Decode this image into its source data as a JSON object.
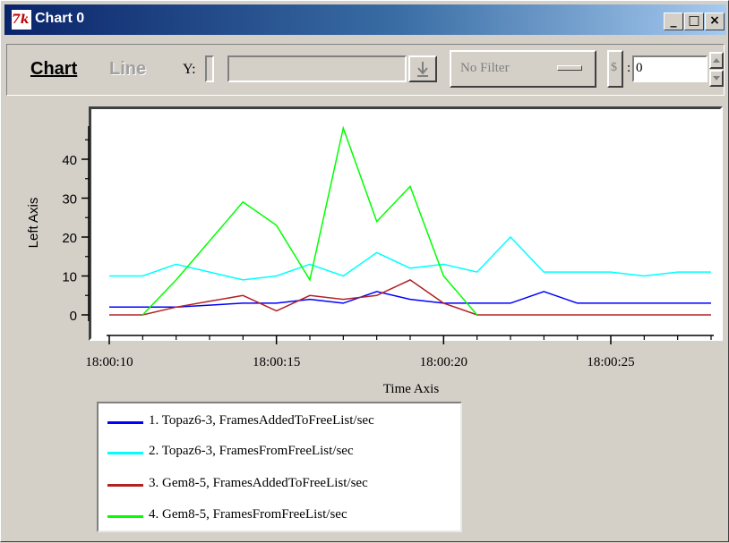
{
  "window": {
    "title": "Chart 0",
    "tk_logo": "7k",
    "buttons": {
      "minimize": "_",
      "maximize": "□",
      "close": "×"
    }
  },
  "toolbar": {
    "menu_chart": "Chart",
    "menu_line": "Line",
    "y_label": "Y:",
    "filter_value": "No Filter",
    "dollar_label": "$",
    "colon": ":",
    "offset_value": "0"
  },
  "colors": {
    "series1": "#0000ff",
    "series2": "#00ffff",
    "series3": "#b22222",
    "series4": "#00ff00"
  },
  "chart_data": {
    "type": "line",
    "xlabel": "Time Axis",
    "ylabel": "Left Axis",
    "x_tick_labels": [
      "18:00:10",
      "18:00:15",
      "18:00:20",
      "18:00:25"
    ],
    "x_ticks_seconds": [
      10,
      15,
      20,
      25
    ],
    "x_minor_ticks_seconds": [
      11,
      12,
      13,
      14,
      16,
      17,
      18,
      19,
      21,
      22,
      23,
      24,
      26,
      27,
      28
    ],
    "xlim": [
      10,
      28
    ],
    "y_ticks": [
      0,
      10,
      20,
      30,
      40
    ],
    "y_minor_ticks": [
      5,
      15,
      25,
      35,
      45
    ],
    "ylim": [
      -1,
      48
    ],
    "grid": false,
    "legend_position": "bottom-left, below plot",
    "x": [
      10,
      11,
      12,
      13,
      14,
      15,
      16,
      17,
      18,
      19,
      20,
      21,
      22,
      23,
      24,
      25,
      26,
      27,
      28
    ],
    "series": [
      {
        "name": "1.  Topaz6-3, FramesAddedToFreeList/sec",
        "color": "#0000ff",
        "values": [
          2,
          2,
          2,
          2.5,
          3,
          3,
          4,
          3,
          6,
          4,
          3,
          3,
          3,
          6,
          3,
          3,
          3,
          3,
          3
        ]
      },
      {
        "name": "2.  Topaz6-3, FramesFromFreeList/sec",
        "color": "#00ffff",
        "values": [
          10,
          10,
          13,
          11,
          9,
          10,
          13,
          10,
          16,
          12,
          13,
          11,
          20,
          11,
          11,
          11,
          10,
          11,
          11
        ]
      },
      {
        "name": "3.  Gem8-5, FramesAddedToFreeList/sec",
        "color": "#b22222",
        "values": [
          0,
          0,
          2,
          3.5,
          5,
          1,
          5,
          4,
          5,
          9,
          3,
          0,
          0,
          0,
          0,
          0,
          0,
          0,
          0
        ]
      },
      {
        "name": "4.  Gem8-5, FramesFromFreeList/sec",
        "color": "#00ff00",
        "values": [
          null,
          0,
          9,
          19,
          29,
          23,
          9,
          48,
          24,
          33,
          10,
          0,
          null,
          null,
          null,
          null,
          null,
          null,
          null
        ]
      }
    ]
  }
}
